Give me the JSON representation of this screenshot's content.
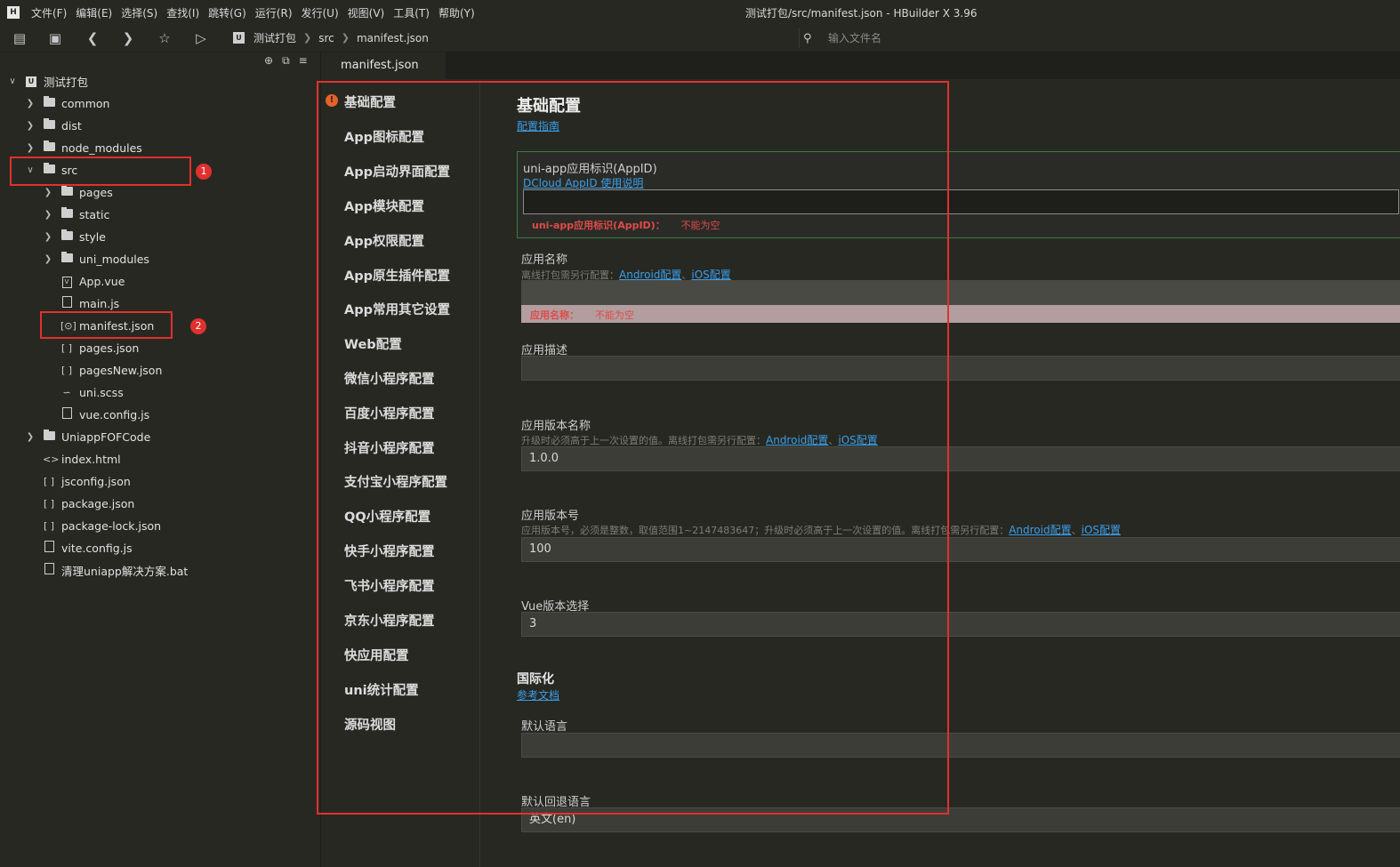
{
  "menu": {
    "items": [
      "文件(F)",
      "编辑(E)",
      "选择(S)",
      "查找(I)",
      "跳转(G)",
      "运行(R)",
      "发行(U)",
      "视图(V)",
      "工具(T)",
      "帮助(Y)"
    ],
    "window_title": "测试打包/src/manifest.json - HBuilder X 3.96"
  },
  "toolbar": {
    "breadcrumb": [
      "测试打包",
      "src",
      "manifest.json"
    ],
    "file_search_placeholder": "输入文件名"
  },
  "sidebar": {
    "project": "测试打包",
    "tree": [
      {
        "label": "common",
        "type": "folder"
      },
      {
        "label": "dist",
        "type": "folder"
      },
      {
        "label": "node_modules",
        "type": "folder"
      },
      {
        "label": "src",
        "type": "folder-open"
      },
      {
        "label": "pages",
        "type": "folder"
      },
      {
        "label": "static",
        "type": "folder"
      },
      {
        "label": "style",
        "type": "folder"
      },
      {
        "label": "uni_modules",
        "type": "folder"
      },
      {
        "label": "App.vue",
        "type": "vue"
      },
      {
        "label": "main.js",
        "type": "js"
      },
      {
        "label": "manifest.json",
        "type": "manifest"
      },
      {
        "label": "pages.json",
        "type": "json"
      },
      {
        "label": "pagesNew.json",
        "type": "json"
      },
      {
        "label": "uni.scss",
        "type": "scss"
      },
      {
        "label": "vue.config.js",
        "type": "js"
      },
      {
        "label": "UniappFOFCode",
        "type": "folder"
      },
      {
        "label": "index.html",
        "type": "html"
      },
      {
        "label": "jsconfig.json",
        "type": "json"
      },
      {
        "label": "package.json",
        "type": "json"
      },
      {
        "label": "package-lock.json",
        "type": "json"
      },
      {
        "label": "vite.config.js",
        "type": "js"
      },
      {
        "label": "清理uniapp解决方案.bat",
        "type": "bat"
      }
    ],
    "badges": [
      "1",
      "2"
    ]
  },
  "editor": {
    "tab": "manifest.json",
    "nav": [
      "基础配置",
      "App图标配置",
      "App启动界面配置",
      "App模块配置",
      "App权限配置",
      "App原生插件配置",
      "App常用其它设置",
      "Web配置",
      "微信小程序配置",
      "百度小程序配置",
      "抖音小程序配置",
      "支付宝小程序配置",
      "QQ小程序配置",
      "快手小程序配置",
      "飞书小程序配置",
      "京东小程序配置",
      "快应用配置",
      "uni统计配置",
      "源码视图"
    ]
  },
  "form": {
    "title": "基础配置",
    "guide_link": "配置指南",
    "appid": {
      "label": "uni-app应用标识(AppID)",
      "link": "DCloud AppID 使用说明",
      "error_label": "uni-app应用标识(AppID)：",
      "error_msg": "不能为空"
    },
    "app_name": {
      "label": "应用名称",
      "desc": "离线打包需另行配置：",
      "link_android": "Android配置",
      "sep": "、",
      "link_ios": "iOS配置",
      "error_label": "应用名称：",
      "error_msg": "不能为空"
    },
    "app_desc": {
      "label": "应用描述"
    },
    "version_name": {
      "label": "应用版本名称",
      "desc": "升级时必须高于上一次设置的值。离线打包需另行配置：",
      "link_android": "Android配置",
      "sep": "、",
      "link_ios": "iOS配置",
      "value": "1.0.0"
    },
    "version_code": {
      "label": "应用版本号",
      "desc": "应用版本号，必须是整数，取值范围1~2147483647；升级时必须高于上一次设置的值。离线打包需另行配置：",
      "link_android": "Android配置",
      "sep": "、",
      "link_ios": "iOS配置",
      "value": "100"
    },
    "vue_version": {
      "label": "Vue版本选择",
      "value": "3"
    },
    "i18n": {
      "title": "国际化",
      "link": "参考文档"
    },
    "default_lang": {
      "label": "默认语言"
    },
    "fallback_lang": {
      "label": "默认回退语言",
      "value": "英文(en)"
    }
  },
  "colors": {
    "highlight_box": "#e0312e",
    "link": "#3b9ee8",
    "error": "#e04a4a",
    "warning_icon": "#e6622a"
  }
}
